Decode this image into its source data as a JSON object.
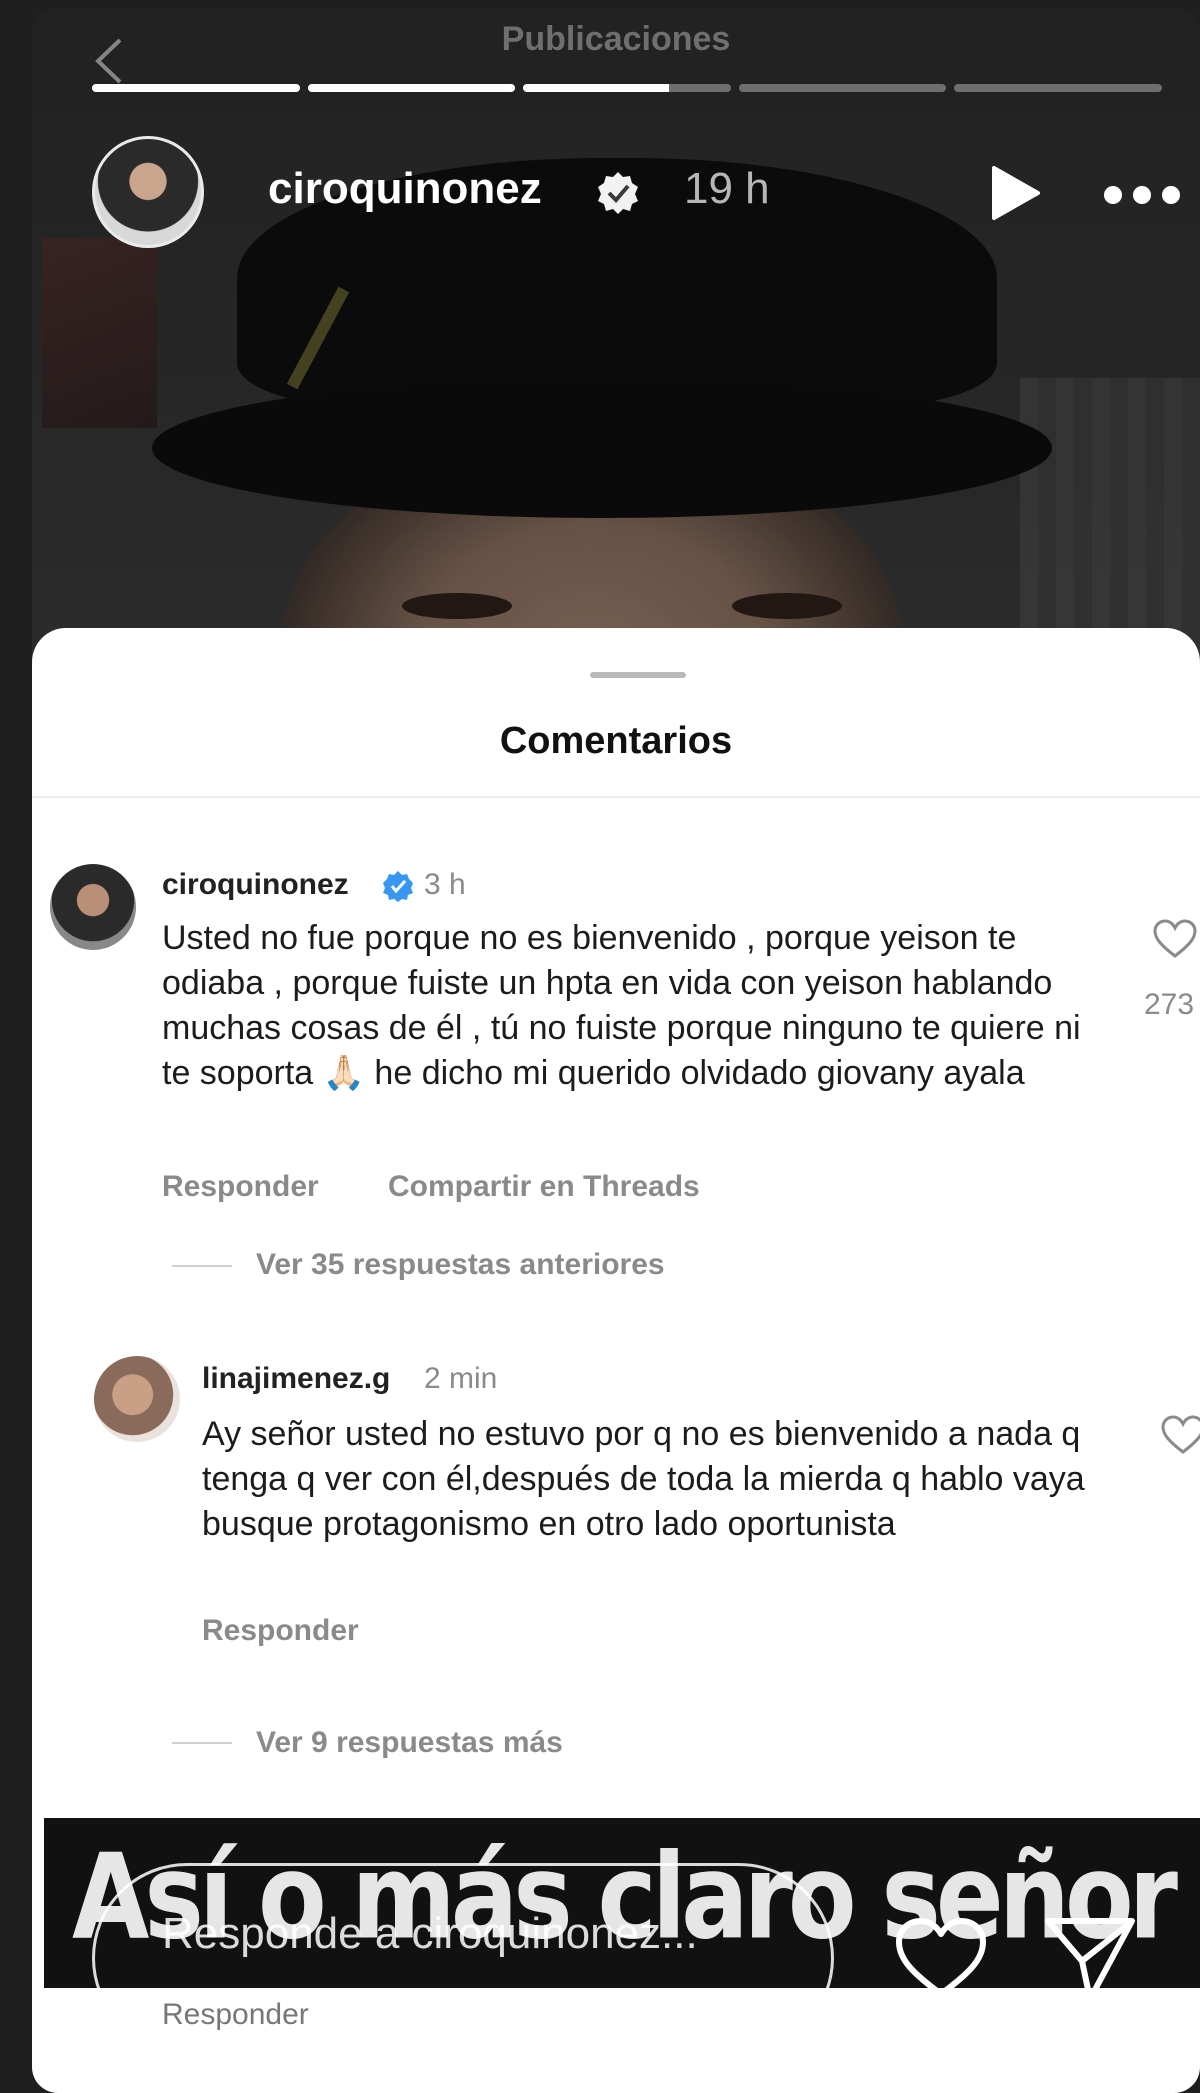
{
  "header": {
    "faint_title": "Publicaciones",
    "username": "ciroquinonez",
    "time": "19 h",
    "progress_segments": [
      1,
      1,
      0.7,
      0,
      0
    ]
  },
  "comments_sheet": {
    "title": "Comentarios",
    "comments": [
      {
        "username": "ciroquinonez",
        "verified": true,
        "time": "3 h",
        "text": "Usted no fue porque no es bienvenido , porque yeison te odiaba , porque fuiste un hpta en vida con yeison hablando muchas cosas de él , tú no fuiste porque ninguno te quiere ni te soporta 🙏🏻 he dicho mi querido olvidado giovany ayala",
        "like_count": "273",
        "actions": [
          "Responder",
          "Compartir en Threads"
        ],
        "view_replies": "Ver 35 respuestas anteriores"
      },
      {
        "username": "linajimenez.g",
        "verified": false,
        "time": "2 min",
        "text": "Ay señor usted no estuvo por q no es bienvenido a nada q tenga q ver con él,después de toda la mierda q hablo vaya busque protagonismo en otro lado oportunista",
        "actions": [
          "Responder"
        ],
        "view_replies": "Ver 9 respuestas más"
      }
    ]
  },
  "overlay": {
    "banner_text": "Así o más claro señor ayala ?",
    "reply_placeholder": "Responde a ciroquinonez...",
    "under_reply": "Responder"
  },
  "colors": {
    "verified_blue": "#3897f0",
    "sheet_bg": "#ffffff",
    "muted_text": "#8a8a8a"
  },
  "icons": [
    "back-arrow-icon",
    "verified-badge-icon",
    "play-icon",
    "more-dots-icon",
    "heart-icon",
    "send-icon"
  ]
}
